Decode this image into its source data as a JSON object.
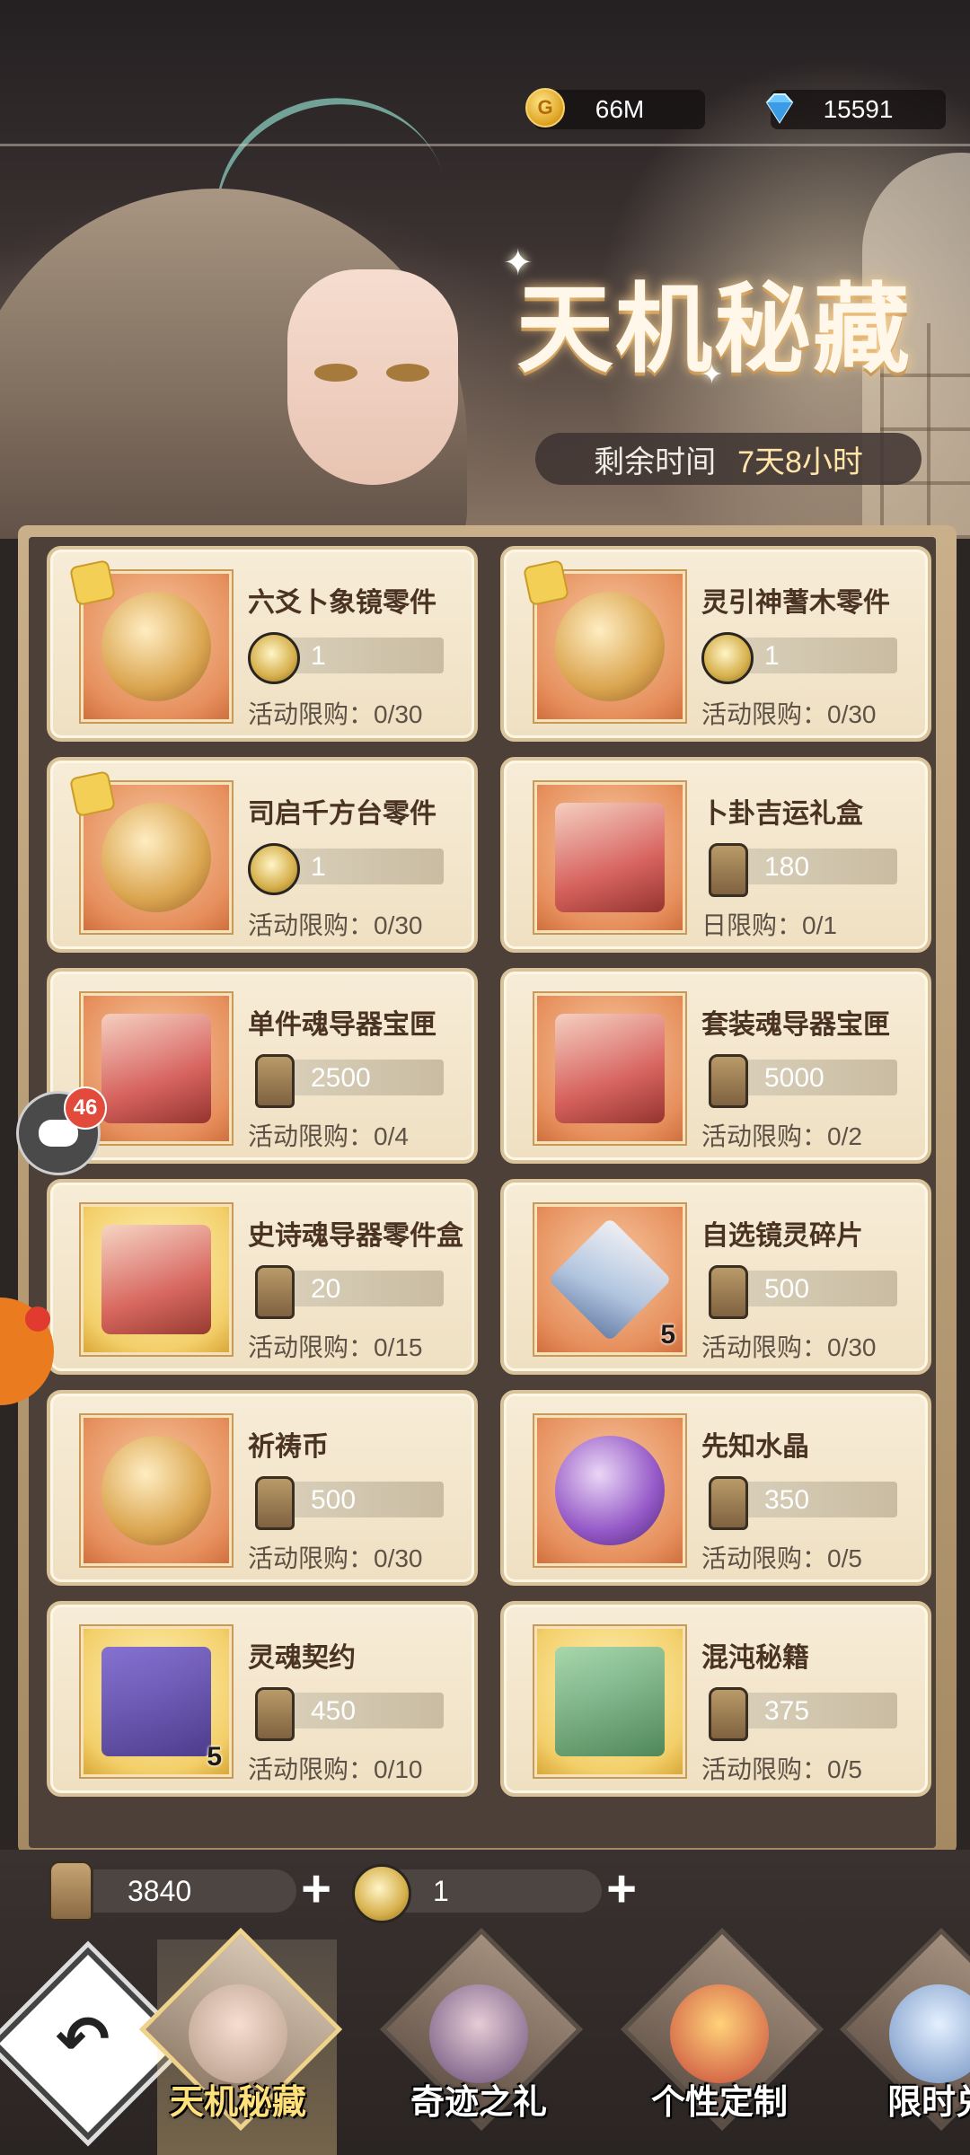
{
  "header": {
    "gold_amount": "66M",
    "gem_amount": "15591",
    "gold_icon": "gold-coin-icon",
    "gem_icon": "diamond-icon"
  },
  "event": {
    "title": "天机秘藏",
    "timer_label": "剩余时间",
    "timer_value": "7天8小时"
  },
  "shop": {
    "items": [
      {
        "name": "六爻卜象镜零件",
        "price": "1",
        "limit": "活动限购：0/30",
        "currency": "token"
      },
      {
        "name": "灵引神蓍木零件",
        "price": "1",
        "limit": "活动限购：0/30",
        "currency": "token"
      },
      {
        "name": "司启千方台零件",
        "price": "1",
        "limit": "活动限购：0/30",
        "currency": "token"
      },
      {
        "name": "卜卦吉运礼盒",
        "price": "180",
        "limit": "日限购：0/1",
        "currency": "tag"
      },
      {
        "name": "单件魂导器宝匣",
        "price": "2500",
        "limit": "活动限购：0/4",
        "currency": "tag"
      },
      {
        "name": "套装魂导器宝匣",
        "price": "5000",
        "limit": "活动限购：0/2",
        "currency": "tag"
      },
      {
        "name": "史诗魂导器零件盒",
        "price": "20",
        "limit": "活动限购：0/15",
        "currency": "tag"
      },
      {
        "name": "自选镜灵碎片",
        "price": "500",
        "limit": "活动限购：0/30",
        "currency": "tag",
        "qty": "5"
      },
      {
        "name": "祈祷币",
        "price": "500",
        "limit": "活动限购：0/30",
        "currency": "tag"
      },
      {
        "name": "先知水晶",
        "price": "350",
        "limit": "活动限购：0/5",
        "currency": "tag"
      },
      {
        "name": "灵魂契约",
        "price": "450",
        "limit": "活动限购：0/10",
        "currency": "tag",
        "qty": "5"
      },
      {
        "name": "混沌秘籍",
        "price": "375",
        "limit": "活动限购：0/5",
        "currency": "tag"
      }
    ]
  },
  "floaters": {
    "chat_badge": "46"
  },
  "balances": {
    "tag_amount": "3840",
    "token_amount": "1",
    "plus_label": "+"
  },
  "nav": {
    "back_label": "↶",
    "tabs": [
      {
        "label": "天机秘藏"
      },
      {
        "label": "奇迹之礼"
      },
      {
        "label": "个性定制"
      },
      {
        "label": "限时兑"
      }
    ]
  }
}
